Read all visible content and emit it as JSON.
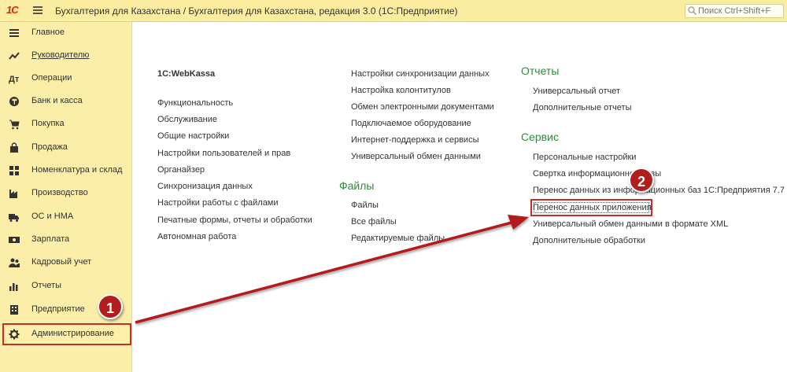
{
  "titlebar": {
    "logo": "1С",
    "title": "Бухгалтерия для Казахстана / Бухгалтерия для Казахстана, редакция 3.0  (1С:Предприятие)",
    "search_placeholder": "Поиск Ctrl+Shift+F"
  },
  "sidebar": {
    "items": [
      {
        "label": "Главное",
        "icon": "list-icon"
      },
      {
        "label": "Руководителю",
        "icon": "trend-icon"
      },
      {
        "label": "Операции",
        "icon": "operations-icon"
      },
      {
        "label": "Банк и касса",
        "icon": "coins-icon"
      },
      {
        "label": "Покупка",
        "icon": "cart-icon"
      },
      {
        "label": "Продажа",
        "icon": "bag-icon"
      },
      {
        "label": "Номенклатура и склад",
        "icon": "grid-icon"
      },
      {
        "label": "Производство",
        "icon": "factory-icon"
      },
      {
        "label": "ОС и НМА",
        "icon": "truck-icon"
      },
      {
        "label": "Зарплата",
        "icon": "money-icon"
      },
      {
        "label": "Кадровый учет",
        "icon": "people-icon"
      },
      {
        "label": "Отчеты",
        "icon": "bar-chart-icon"
      },
      {
        "label": "Предприятие",
        "icon": "building-icon"
      },
      {
        "label": "Администрирование",
        "icon": "gear-icon"
      }
    ]
  },
  "main": {
    "col1": {
      "group_title": "1C:WebKassa",
      "links": [
        "Функциональность",
        "Обслуживание",
        "Общие настройки",
        "Настройки пользователей и прав",
        "Органайзер",
        "Синхронизация данных",
        "Настройки работы с файлами",
        "Печатные формы, отчеты и обработки",
        "Автономная работа"
      ]
    },
    "col2": {
      "links": [
        "Настройки синхронизации данных",
        "Настройка колонтитулов",
        "Обмен электронными документами",
        "Подключаемое оборудование",
        "Интернет-поддержка и сервисы",
        "Универсальный обмен данными"
      ],
      "files_title": "Файлы",
      "files_links": [
        "Файлы",
        "Все файлы",
        "Редактируемые файлы"
      ]
    },
    "col3": {
      "reports_title": "Отчеты",
      "reports_links": [
        "Универсальный отчет",
        "Дополнительные отчеты"
      ],
      "service_title": "Сервис",
      "service_links": [
        "Персональные настройки",
        "Свертка информационной базы",
        "Перенос данных из информационных баз 1С:Предприятия 7.7",
        "Перенос данных приложения",
        "Универсальный обмен данными в формате XML",
        "Дополнительные обработки"
      ]
    }
  },
  "callouts": {
    "step1": "1",
    "step2": "2"
  },
  "colors": {
    "accent": "#c0312b",
    "section": "#2e8b3e",
    "sidebar": "#fbeea8"
  }
}
